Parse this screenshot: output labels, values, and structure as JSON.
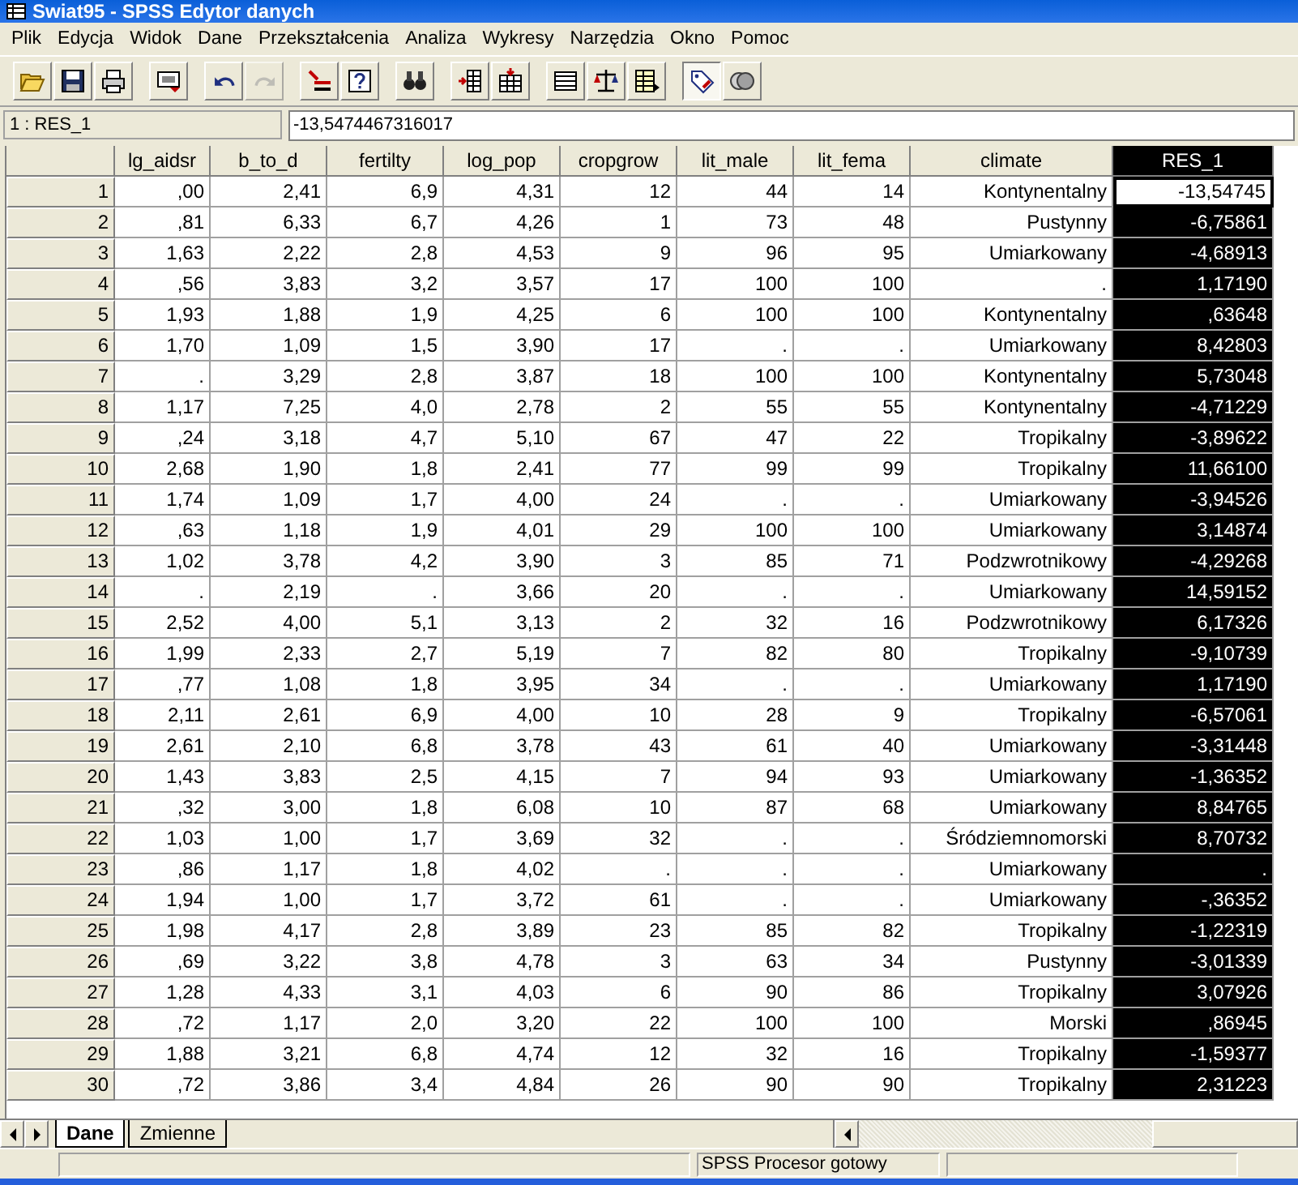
{
  "window": {
    "title": "Swiat95 - SPSS Edytor danych"
  },
  "menu": [
    "Plik",
    "Edycja",
    "Widok",
    "Dane",
    "Przekształcenia",
    "Analiza",
    "Wykresy",
    "Narzędzia",
    "Okno",
    "Pomoc"
  ],
  "toolbar": [
    {
      "kind": "open",
      "disabled": false,
      "pressed": false
    },
    {
      "kind": "save",
      "disabled": false,
      "pressed": false
    },
    {
      "kind": "print",
      "disabled": false,
      "pressed": false
    },
    {
      "kind": "sep"
    },
    {
      "kind": "dialog",
      "disabled": false,
      "pressed": false
    },
    {
      "kind": "sep"
    },
    {
      "kind": "undo",
      "disabled": false,
      "pressed": false
    },
    {
      "kind": "redo",
      "disabled": true,
      "pressed": false
    },
    {
      "kind": "sep"
    },
    {
      "kind": "goto",
      "disabled": false,
      "pressed": false
    },
    {
      "kind": "variables",
      "disabled": false,
      "pressed": false
    },
    {
      "kind": "sep"
    },
    {
      "kind": "find",
      "disabled": false,
      "pressed": false
    },
    {
      "kind": "sep"
    },
    {
      "kind": "insertcase",
      "disabled": false,
      "pressed": false
    },
    {
      "kind": "insertvar",
      "disabled": false,
      "pressed": false
    },
    {
      "kind": "sep"
    },
    {
      "kind": "split",
      "disabled": false,
      "pressed": false
    },
    {
      "kind": "weight",
      "disabled": false,
      "pressed": false
    },
    {
      "kind": "select",
      "disabled": false,
      "pressed": false
    },
    {
      "kind": "sep"
    },
    {
      "kind": "labels",
      "disabled": false,
      "pressed": true
    },
    {
      "kind": "sets",
      "disabled": false,
      "pressed": false
    }
  ],
  "cell_editor": {
    "cell": "1 : RES_1",
    "value": "-13,5474467316017"
  },
  "table": {
    "columns": [
      {
        "name": "lg_aidsr",
        "selected": false
      },
      {
        "name": "b_to_d",
        "selected": false
      },
      {
        "name": "fertilty",
        "selected": false
      },
      {
        "name": "log_pop",
        "selected": false
      },
      {
        "name": "cropgrow",
        "selected": false
      },
      {
        "name": "lit_male",
        "selected": false
      },
      {
        "name": "lit_fema",
        "selected": false
      },
      {
        "name": "climate",
        "selected": false
      },
      {
        "name": "RES_1",
        "selected": true
      }
    ],
    "rows": [
      {
        "num": "1",
        "current": true,
        "cells": [
          ",00",
          "2,41",
          "6,9",
          "4,31",
          "12",
          "44",
          "14",
          "Kontynentalny",
          "-13,54745"
        ]
      },
      {
        "num": "2",
        "current": false,
        "cells": [
          ",81",
          "6,33",
          "6,7",
          "4,26",
          "1",
          "73",
          "48",
          "Pustynny",
          "-6,75861"
        ]
      },
      {
        "num": "3",
        "current": false,
        "cells": [
          "1,63",
          "2,22",
          "2,8",
          "4,53",
          "9",
          "96",
          "95",
          "Umiarkowany",
          "-4,68913"
        ]
      },
      {
        "num": "4",
        "current": false,
        "cells": [
          ",56",
          "3,83",
          "3,2",
          "3,57",
          "17",
          "100",
          "100",
          ".",
          "1,17190"
        ]
      },
      {
        "num": "5",
        "current": false,
        "cells": [
          "1,93",
          "1,88",
          "1,9",
          "4,25",
          "6",
          "100",
          "100",
          "Kontynentalny",
          ",63648"
        ]
      },
      {
        "num": "6",
        "current": false,
        "cells": [
          "1,70",
          "1,09",
          "1,5",
          "3,90",
          "17",
          ".",
          ".",
          "Umiarkowany",
          "8,42803"
        ]
      },
      {
        "num": "7",
        "current": false,
        "cells": [
          ".",
          "3,29",
          "2,8",
          "3,87",
          "18",
          "100",
          "100",
          "Kontynentalny",
          "5,73048"
        ]
      },
      {
        "num": "8",
        "current": false,
        "cells": [
          "1,17",
          "7,25",
          "4,0",
          "2,78",
          "2",
          "55",
          "55",
          "Kontynentalny",
          "-4,71229"
        ]
      },
      {
        "num": "9",
        "current": false,
        "cells": [
          ",24",
          "3,18",
          "4,7",
          "5,10",
          "67",
          "47",
          "22",
          "Tropikalny",
          "-3,89622"
        ]
      },
      {
        "num": "10",
        "current": false,
        "cells": [
          "2,68",
          "1,90",
          "1,8",
          "2,41",
          "77",
          "99",
          "99",
          "Tropikalny",
          "11,66100"
        ]
      },
      {
        "num": "11",
        "current": false,
        "cells": [
          "1,74",
          "1,09",
          "1,7",
          "4,00",
          "24",
          ".",
          ".",
          "Umiarkowany",
          "-3,94526"
        ]
      },
      {
        "num": "12",
        "current": false,
        "cells": [
          ",63",
          "1,18",
          "1,9",
          "4,01",
          "29",
          "100",
          "100",
          "Umiarkowany",
          "3,14874"
        ]
      },
      {
        "num": "13",
        "current": false,
        "cells": [
          "1,02",
          "3,78",
          "4,2",
          "3,90",
          "3",
          "85",
          "71",
          "Podzwrotnikowy",
          "-4,29268"
        ]
      },
      {
        "num": "14",
        "current": false,
        "cells": [
          ".",
          "2,19",
          ".",
          "3,66",
          "20",
          ".",
          ".",
          "Umiarkowany",
          "14,59152"
        ]
      },
      {
        "num": "15",
        "current": false,
        "cells": [
          "2,52",
          "4,00",
          "5,1",
          "3,13",
          "2",
          "32",
          "16",
          "Podzwrotnikowy",
          "6,17326"
        ]
      },
      {
        "num": "16",
        "current": false,
        "cells": [
          "1,99",
          "2,33",
          "2,7",
          "5,19",
          "7",
          "82",
          "80",
          "Tropikalny",
          "-9,10739"
        ]
      },
      {
        "num": "17",
        "current": false,
        "cells": [
          ",77",
          "1,08",
          "1,8",
          "3,95",
          "34",
          ".",
          ".",
          "Umiarkowany",
          "1,17190"
        ]
      },
      {
        "num": "18",
        "current": false,
        "cells": [
          "2,11",
          "2,61",
          "6,9",
          "4,00",
          "10",
          "28",
          "9",
          "Tropikalny",
          "-6,57061"
        ]
      },
      {
        "num": "19",
        "current": false,
        "cells": [
          "2,61",
          "2,10",
          "6,8",
          "3,78",
          "43",
          "61",
          "40",
          "Umiarkowany",
          "-3,31448"
        ]
      },
      {
        "num": "20",
        "current": false,
        "cells": [
          "1,43",
          "3,83",
          "2,5",
          "4,15",
          "7",
          "94",
          "93",
          "Umiarkowany",
          "-1,36352"
        ]
      },
      {
        "num": "21",
        "current": false,
        "cells": [
          ",32",
          "3,00",
          "1,8",
          "6,08",
          "10",
          "87",
          "68",
          "Umiarkowany",
          "8,84765"
        ]
      },
      {
        "num": "22",
        "current": false,
        "cells": [
          "1,03",
          "1,00",
          "1,7",
          "3,69",
          "32",
          ".",
          ".",
          "Śródziemnomorski",
          "8,70732"
        ]
      },
      {
        "num": "23",
        "current": false,
        "cells": [
          ",86",
          "1,17",
          "1,8",
          "4,02",
          ".",
          ".",
          ".",
          "Umiarkowany",
          "."
        ]
      },
      {
        "num": "24",
        "current": false,
        "cells": [
          "1,94",
          "1,00",
          "1,7",
          "3,72",
          "61",
          ".",
          ".",
          "Umiarkowany",
          "-,36352"
        ]
      },
      {
        "num": "25",
        "current": false,
        "cells": [
          "1,98",
          "4,17",
          "2,8",
          "3,89",
          "23",
          "85",
          "82",
          "Tropikalny",
          "-1,22319"
        ]
      },
      {
        "num": "26",
        "current": false,
        "cells": [
          ",69",
          "3,22",
          "3,8",
          "4,78",
          "3",
          "63",
          "34",
          "Pustynny",
          "-3,01339"
        ]
      },
      {
        "num": "27",
        "current": false,
        "cells": [
          "1,28",
          "4,33",
          "3,1",
          "4,03",
          "6",
          "90",
          "86",
          "Tropikalny",
          "3,07926"
        ]
      },
      {
        "num": "28",
        "current": false,
        "cells": [
          ",72",
          "1,17",
          "2,0",
          "3,20",
          "22",
          "100",
          "100",
          "Morski",
          ",86945"
        ]
      },
      {
        "num": "29",
        "current": false,
        "cells": [
          "1,88",
          "3,21",
          "6,8",
          "4,74",
          "12",
          "32",
          "16",
          "Tropikalny",
          "-1,59377"
        ]
      },
      {
        "num": "30",
        "current": false,
        "cells": [
          ",72",
          "3,86",
          "3,4",
          "4,84",
          "26",
          "90",
          "90",
          "Tropikalny",
          "2,31223"
        ]
      }
    ]
  },
  "sheet_tabs": [
    {
      "label": "Dane",
      "selected": true
    },
    {
      "label": "Zmienne",
      "selected": false
    }
  ],
  "status_bar": {
    "text": "SPSS Procesor  gotowy"
  }
}
